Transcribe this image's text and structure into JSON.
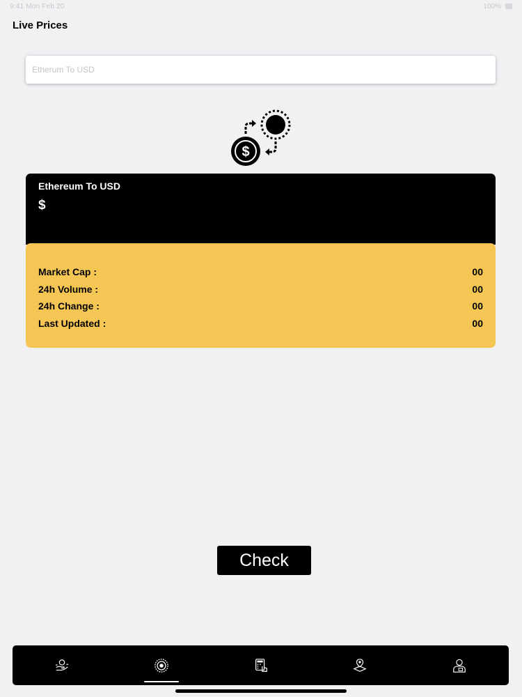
{
  "status_bar": {
    "left_text": "9:41  Mon Feb 20",
    "right_text": "100%"
  },
  "header": {
    "title": "Live Prices"
  },
  "search": {
    "placeholder": "Etherum To USD",
    "value": ""
  },
  "exchange_icon": {
    "name": "currency-exchange-icon"
  },
  "price_card": {
    "title": "Ethereum To USD",
    "price": "$",
    "colors": {
      "header_bg": "#000000",
      "stats_bg": "#f6c655"
    }
  },
  "stats": [
    {
      "label": "Market Cap :",
      "value": "00"
    },
    {
      "label": "24h Volume :",
      "value": "00"
    },
    {
      "label": "24h Change :",
      "value": "00"
    },
    {
      "label": "Last Updated :",
      "value": "00"
    }
  ],
  "check_button": {
    "label": "Check"
  },
  "tab_bar": {
    "selected_index": 1,
    "tabs": [
      {
        "icon": "hand-coin-icon"
      },
      {
        "icon": "target-radar-icon"
      },
      {
        "icon": "calculator-tap-icon"
      },
      {
        "icon": "location-pin-icon"
      },
      {
        "icon": "user-profile-icon"
      }
    ]
  }
}
